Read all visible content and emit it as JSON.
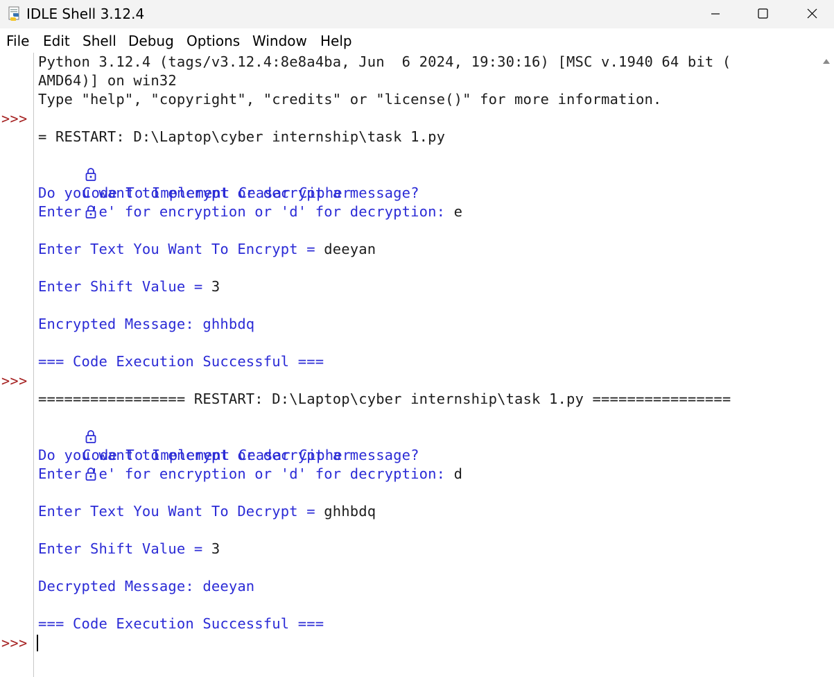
{
  "window": {
    "title": "IDLE Shell 3.12.4"
  },
  "menu": {
    "items": [
      "File",
      "Edit",
      "Shell",
      "Debug",
      "Options",
      "Window",
      "Help"
    ]
  },
  "colors": {
    "prompt": "#a52020",
    "stdout": "#2b2bd6",
    "input": "#1c1c1c"
  },
  "icons": {
    "app": "python-idle-icon",
    "lock": "lock-icon",
    "minimize": "minimize-icon",
    "maximize": "maximize-icon",
    "close": "close-icon",
    "scroll_up": "scroll-up-arrow-icon"
  },
  "prompt": ">>>",
  "shell": {
    "banner1": "Python 3.12.4 (tags/v3.12.4:8e8a4ba, Jun  6 2024, 19:30:16) [MSC v.1940 64 bit (",
    "banner2": "AMD64)] on win32",
    "banner3": "Type \"help\", \"copyright\", \"credits\" or \"license()\" for more information.",
    "restart1": "= RESTART: D:\\Laptop\\cyber internship\\task 1.py",
    "heading": "Code To Implement Ceasar Cipher",
    "question": "Do you want to encrypt or decrypt a message?",
    "choice_prompt": "Enter 'e' for encryption or 'd' for decryption: ",
    "choice_e": "e",
    "enc_prompt": "Enter Text You Want To Encrypt = ",
    "enc_input": "deeyan",
    "shift_prompt": "Enter Shift Value = ",
    "shift_input": "3",
    "encrypted": "Encrypted Message: ghhbdq",
    "success": "=== Code Execution Successful ===",
    "restart2": "================= RESTART: D:\\Laptop\\cyber internship\\task 1.py ================",
    "choice_d": "d",
    "dec_prompt": "Enter Text You Want To Decrypt = ",
    "dec_input": "ghhbdq",
    "shift_input2": "3",
    "decrypted": "Decrypted Message: deeyan"
  }
}
